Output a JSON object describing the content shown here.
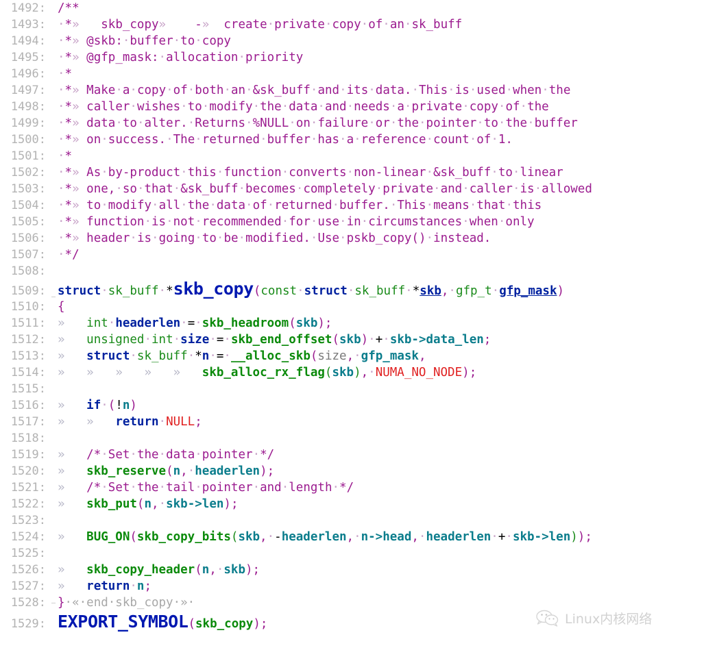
{
  "editor": {
    "app": "code-viewer",
    "language": "C",
    "first_line_number": 1492,
    "last_line_number": 1529,
    "colors": {
      "background": "#ffffff",
      "line_number": "#b3b3b3",
      "comment": "#9b1b8f",
      "keyword": "#00219f",
      "type": "#1a8b1a",
      "function": "#0b8a0b",
      "variable": "#0b7d8c",
      "constant": "#e02020",
      "fold_text": "#a8a8a8",
      "indent_guide": "#cfcfcf"
    },
    "lines": [
      {
        "n": "1492",
        "text": "/**"
      },
      {
        "n": "1493",
        "text": " * skb_copy»    -»  create private copy of an sk_buff"
      },
      {
        "n": "1494",
        "text": " * @skb: buffer to copy"
      },
      {
        "n": "1495",
        "text": " * @gfp_mask: allocation priority"
      },
      {
        "n": "1496",
        "text": " *"
      },
      {
        "n": "1497",
        "text": " * Make a copy of both an &sk_buff and its data. This is used when the"
      },
      {
        "n": "1498",
        "text": " * caller wishes to modify the data and needs a private copy of the"
      },
      {
        "n": "1499",
        "text": " * data to alter. Returns %NULL on failure or the pointer to the buffer"
      },
      {
        "n": "1500",
        "text": " * on success. The returned buffer has a reference count of 1."
      },
      {
        "n": "1501",
        "text": " *"
      },
      {
        "n": "1502",
        "text": " * As by-product this function converts non-linear &sk_buff to linear"
      },
      {
        "n": "1503",
        "text": " * one, so that &sk_buff becomes completely private and caller is allowed"
      },
      {
        "n": "1504",
        "text": " * to modify all the data of returned buffer. This means that this"
      },
      {
        "n": "1505",
        "text": " * function is not recommended for use in circumstances when only"
      },
      {
        "n": "1506",
        "text": " * header is going to be modified. Use pskb_copy() instead."
      },
      {
        "n": "1507",
        "text": " */"
      },
      {
        "n": "1508",
        "text": ""
      },
      {
        "n": "1509",
        "text": "struct sk_buff *skb_copy(const struct sk_buff *skb, gfp_t gfp_mask)"
      },
      {
        "n": "1510",
        "text": "{"
      },
      {
        "n": "1511",
        "text": "\tint headerlen = skb_headroom(skb);"
      },
      {
        "n": "1512",
        "text": "\tunsigned int size = skb_end_offset(skb) + skb->data_len;"
      },
      {
        "n": "1513",
        "text": "\tstruct sk_buff *n = __alloc_skb(size, gfp_mask,"
      },
      {
        "n": "1514",
        "text": "\t\t\t\t\tskb_alloc_rx_flag(skb), NUMA_NO_NODE);"
      },
      {
        "n": "1515",
        "text": ""
      },
      {
        "n": "1516",
        "text": "\tif (!n)"
      },
      {
        "n": "1517",
        "text": "\t\treturn NULL;"
      },
      {
        "n": "1518",
        "text": ""
      },
      {
        "n": "1519",
        "text": "\t/* Set the data pointer */"
      },
      {
        "n": "1520",
        "text": "\tskb_reserve(n, headerlen);"
      },
      {
        "n": "1521",
        "text": "\t/* Set the tail pointer and length */"
      },
      {
        "n": "1522",
        "text": "\tskb_put(n, skb->len);"
      },
      {
        "n": "1523",
        "text": ""
      },
      {
        "n": "1524",
        "text": "\tBUG_ON(skb_copy_bits(skb, -headerlen, n->head, headerlen + skb->len));"
      },
      {
        "n": "1525",
        "text": ""
      },
      {
        "n": "1526",
        "text": "\tskb_copy_header(n, skb);"
      },
      {
        "n": "1527",
        "text": "\treturn n;"
      },
      {
        "n": "1528",
        "text": "} « end skb_copy » "
      },
      {
        "n": "1529",
        "text": "EXPORT_SYMBOL(skb_copy);"
      }
    ],
    "tokens": {
      "ws_space": "·",
      "ws_tab": "»",
      "fold_open": "«",
      "fold_close": "»"
    }
  },
  "watermark": {
    "label": "Linux内核网络",
    "icon": "wechat-icon"
  }
}
